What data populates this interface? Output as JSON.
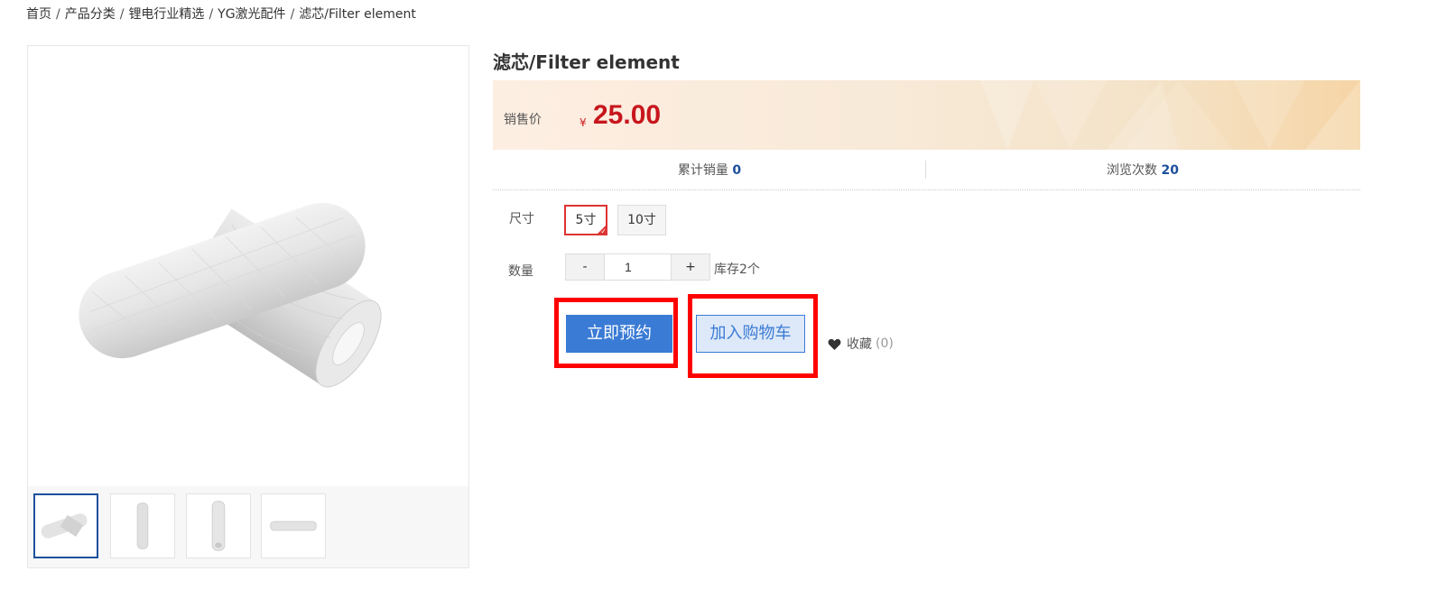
{
  "breadcrumb": [
    "首页",
    "产品分类",
    "锂电行业精选",
    "YG激光配件",
    "滤芯/Filter element"
  ],
  "breadcrumb_separator": "/",
  "product": {
    "title": "滤芯/Filter element",
    "price_label": "销售价",
    "currency": "¥",
    "price": "25.00",
    "sales_label": "累计销量",
    "sales": "0",
    "views_label": "浏览次数",
    "views": "20"
  },
  "spec": {
    "label": "尺寸",
    "options": [
      "5寸",
      "10寸"
    ],
    "selected": "5寸"
  },
  "quantity": {
    "label": "数量",
    "minus": "-",
    "value": "1",
    "plus": "+",
    "stock_text": "库存2个"
  },
  "actions": {
    "reserve": "立即预约",
    "add_to_cart": "加入购物车",
    "favorite_label": "收藏",
    "favorite_count": "(0)"
  },
  "colors": {
    "price": "#c8161d",
    "accent_blue": "#3a7bd5",
    "stat_value": "#1e4f9c",
    "highlight": "#ff0000"
  },
  "icons": [
    "heart-icon",
    "check-icon"
  ]
}
